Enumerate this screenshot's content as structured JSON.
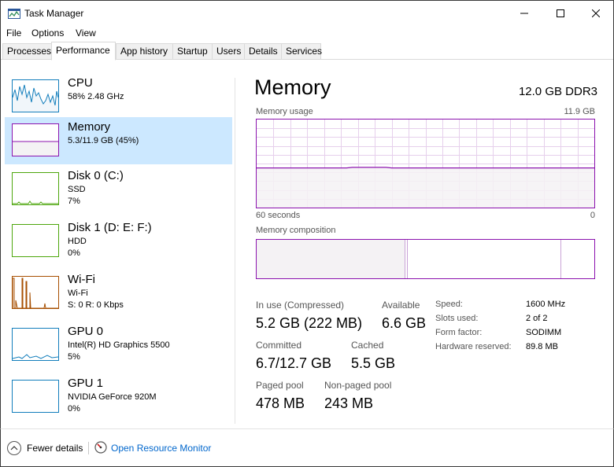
{
  "window": {
    "title": "Task Manager"
  },
  "menu": [
    "File",
    "Options",
    "View"
  ],
  "tabs": [
    "Processes",
    "Performance",
    "App history",
    "Startup",
    "Users",
    "Details",
    "Services"
  ],
  "active_tab": "Performance",
  "sidebar": {
    "items": [
      {
        "title": "CPU",
        "sub1": "58%  2.48 GHz",
        "sub2": "",
        "color": "#117dbb"
      },
      {
        "title": "Memory",
        "sub1": "5.3/11.9 GB (45%)",
        "sub2": "",
        "color": "#8b12ae"
      },
      {
        "title": "Disk 0 (C:)",
        "sub1": "SSD",
        "sub2": "7%",
        "color": "#4da60c"
      },
      {
        "title": "Disk 1 (D: E: F:)",
        "sub1": "HDD",
        "sub2": "0%",
        "color": "#4da60c"
      },
      {
        "title": "Wi-Fi",
        "sub1": "Wi-Fi",
        "sub2": "S: 0 R: 0 Kbps",
        "color": "#a74f01"
      },
      {
        "title": "GPU 0",
        "sub1": "Intel(R) HD Graphics 5500",
        "sub2": "5%",
        "color": "#117dbb"
      },
      {
        "title": "GPU 1",
        "sub1": "NVIDIA GeForce 920M",
        "sub2": "0%",
        "color": "#117dbb"
      }
    ]
  },
  "main": {
    "title": "Memory",
    "spec": "12.0 GB DDR3",
    "usage_label": "Memory usage",
    "usage_max": "11.9 GB",
    "time_label": "60 seconds",
    "time_end": "0",
    "usage_fraction": 0.45,
    "composition_label": "Memory composition",
    "stats": {
      "in_use_label": "In use (Compressed)",
      "in_use_value": "5.2 GB (222 MB)",
      "available_label": "Available",
      "available_value": "6.6 GB",
      "committed_label": "Committed",
      "committed_value": "6.7/12.7 GB",
      "cached_label": "Cached",
      "cached_value": "5.5 GB",
      "paged_label": "Paged pool",
      "paged_value": "478 MB",
      "nonpaged_label": "Non-paged pool",
      "nonpaged_value": "243 MB"
    },
    "specs": {
      "speed_key": "Speed:",
      "speed_val": "1600 MHz",
      "slots_key": "Slots used:",
      "slots_val": "2 of 2",
      "form_key": "Form factor:",
      "form_val": "SODIMM",
      "reserved_key": "Hardware reserved:",
      "reserved_val": "89.8 MB"
    }
  },
  "footer": {
    "fewer_details": "Fewer details",
    "resource_monitor": "Open Resource Monitor"
  },
  "colors": {
    "memory": "#8b12ae",
    "cpu": "#117dbb",
    "disk": "#4da60c",
    "wifi": "#a74f01",
    "link": "#0066cc",
    "selected": "#cce8ff"
  }
}
